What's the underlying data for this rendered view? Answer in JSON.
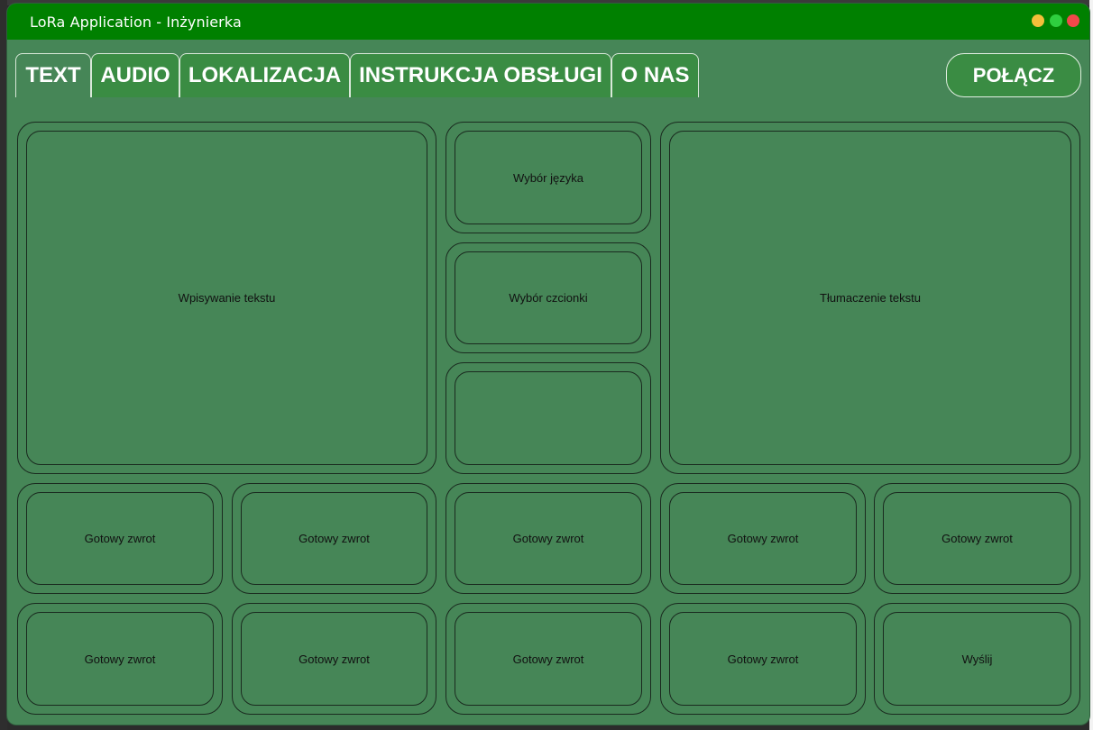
{
  "window": {
    "title": "LoRa Application - Inżynierka",
    "titlebar_color": "#008000",
    "background_color": "#468657"
  },
  "tabs": [
    {
      "label": "TEXT",
      "active": true
    },
    {
      "label": "AUDIO",
      "active": false
    },
    {
      "label": "LOKALIZACJA",
      "active": false
    },
    {
      "label": "INSTRUKCJA OBSŁUGI",
      "active": false
    },
    {
      "label": "O NAS",
      "active": false
    }
  ],
  "connect_button": "POŁĄCZ",
  "panels": {
    "text_input": "Wpisywanie tekstu",
    "language_select": "Wybór języka",
    "font_select": "Wybór czcionki",
    "empty_slot": "",
    "translation": "Tłumaczenie tekstu"
  },
  "phrases": [
    "Gotowy zwrot",
    "Gotowy zwrot",
    "Gotowy zwrot",
    "Gotowy zwrot",
    "Gotowy zwrot",
    "Gotowy zwrot",
    "Gotowy zwrot",
    "Gotowy zwrot",
    "Gotowy zwrot"
  ],
  "send_button": "Wyślij"
}
